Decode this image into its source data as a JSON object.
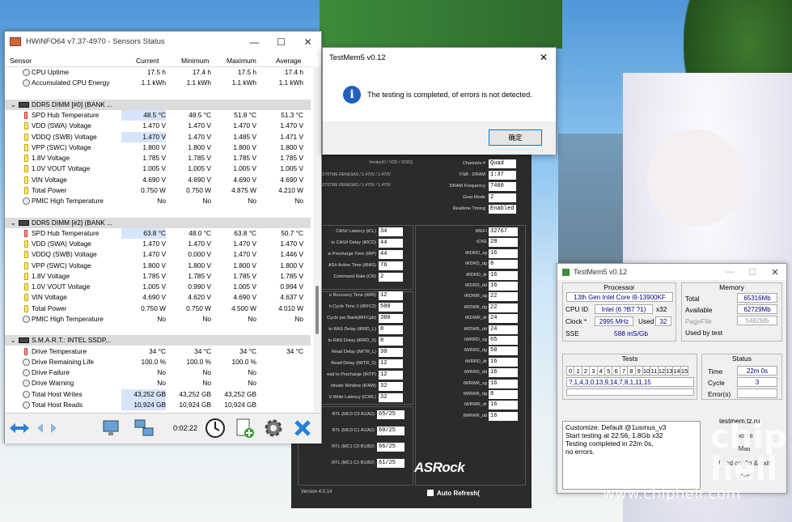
{
  "hwinfo": {
    "title": "HWiNFO64 v7.37-4970 - Sensors Status",
    "columns": {
      "sensor": "Sensor",
      "current": "Current",
      "minimum": "Minimum",
      "maximum": "Maximum",
      "average": "Average"
    },
    "rows": [
      {
        "kind": "item",
        "icon": "clock",
        "name": "CPU Uptime",
        "cur": "17.5 h",
        "min": "17.4 h",
        "max": "17.5 h",
        "avg": "17.4 h"
      },
      {
        "kind": "item",
        "icon": "clock",
        "name": "Accumulated CPU Energy",
        "cur": "1.1 kWh",
        "min": "1.1 kWh",
        "max": "1.1 kWh",
        "avg": "1.1 kWh"
      },
      {
        "kind": "blank"
      },
      {
        "kind": "group",
        "name": "DDR5 DIMM [#0] (BANK ..."
      },
      {
        "kind": "item",
        "icon": "temp",
        "name": "SPD Hub Temperature",
        "cur": "48.5 °C",
        "min": "48.5 °C",
        "max": "51.8 °C",
        "avg": "51.3 °C",
        "hl": true
      },
      {
        "kind": "item",
        "icon": "volt",
        "name": "VDD (SWA) Voltage",
        "cur": "1.470 V",
        "min": "1.470 V",
        "max": "1.470 V",
        "avg": "1.470 V"
      },
      {
        "kind": "item",
        "icon": "volt",
        "name": "VDDQ (SWB) Voltage",
        "cur": "1.470 V",
        "min": "1.470 V",
        "max": "1.485 V",
        "avg": "1.471 V",
        "hl": true
      },
      {
        "kind": "item",
        "icon": "volt",
        "name": "VPP (SWC) Voltage",
        "cur": "1.800 V",
        "min": "1.800 V",
        "max": "1.800 V",
        "avg": "1.800 V"
      },
      {
        "kind": "item",
        "icon": "volt",
        "name": "1.8V Voltage",
        "cur": "1.785 V",
        "min": "1.785 V",
        "max": "1.785 V",
        "avg": "1.785 V"
      },
      {
        "kind": "item",
        "icon": "volt",
        "name": "1.0V VOUT Voltage",
        "cur": "1.005 V",
        "min": "1.005 V",
        "max": "1.005 V",
        "avg": "1.005 V"
      },
      {
        "kind": "item",
        "icon": "volt",
        "name": "VIN Voltage",
        "cur": "4.690 V",
        "min": "4.690 V",
        "max": "4.690 V",
        "avg": "4.690 V"
      },
      {
        "kind": "item",
        "icon": "volt",
        "name": "Total Power",
        "cur": "0.750 W",
        "min": "0.750 W",
        "max": "4.875 W",
        "avg": "4.210 W"
      },
      {
        "kind": "item",
        "icon": "clock",
        "name": "PMIC High Temperature",
        "cur": "No",
        "min": "No",
        "max": "No",
        "avg": "No"
      },
      {
        "kind": "blank"
      },
      {
        "kind": "group",
        "name": "DDR5 DIMM [#2] (BANK ..."
      },
      {
        "kind": "item",
        "icon": "temp",
        "name": "SPD Hub Temperature",
        "cur": "63.8 °C",
        "min": "48.0 °C",
        "max": "63.8 °C",
        "avg": "50.7 °C",
        "hl": true
      },
      {
        "kind": "item",
        "icon": "volt",
        "name": "VDD (SWA) Voltage",
        "cur": "1.470 V",
        "min": "1.470 V",
        "max": "1.470 V",
        "avg": "1.470 V"
      },
      {
        "kind": "item",
        "icon": "volt",
        "name": "VDDQ (SWB) Voltage",
        "cur": "1.470 V",
        "min": "0.000 V",
        "max": "1.470 V",
        "avg": "1.446 V"
      },
      {
        "kind": "item",
        "icon": "volt",
        "name": "VPP (SWC) Voltage",
        "cur": "1.800 V",
        "min": "1.800 V",
        "max": "1.800 V",
        "avg": "1.800 V"
      },
      {
        "kind": "item",
        "icon": "volt",
        "name": "1.8V Voltage",
        "cur": "1.785 V",
        "min": "1.785 V",
        "max": "1.785 V",
        "avg": "1.785 V"
      },
      {
        "kind": "item",
        "icon": "volt",
        "name": "1.0V VOUT Voltage",
        "cur": "1.005 V",
        "min": "0.990 V",
        "max": "1.005 V",
        "avg": "0.994 V"
      },
      {
        "kind": "item",
        "icon": "volt",
        "name": "VIN Voltage",
        "cur": "4.690 V",
        "min": "4.620 V",
        "max": "4.690 V",
        "avg": "4.637 V"
      },
      {
        "kind": "item",
        "icon": "volt",
        "name": "Total Power",
        "cur": "0.750 W",
        "min": "0.750 W",
        "max": "4.500 W",
        "avg": "4.010 W"
      },
      {
        "kind": "item",
        "icon": "clock",
        "name": "PMIC High Temperature",
        "cur": "No",
        "min": "No",
        "max": "No",
        "avg": "No"
      },
      {
        "kind": "blank"
      },
      {
        "kind": "group",
        "name": "S.M.A.R.T.: INTEL SSDP..."
      },
      {
        "kind": "item",
        "icon": "temp",
        "name": "Drive Temperature",
        "cur": "34 °C",
        "min": "34 °C",
        "max": "34 °C",
        "avg": "34 °C"
      },
      {
        "kind": "item",
        "icon": "clock",
        "name": "Drive Remaining Life",
        "cur": "100.0 %",
        "min": "100.0 %",
        "max": "100.0 %",
        "avg": ""
      },
      {
        "kind": "item",
        "icon": "clock",
        "name": "Drive Failure",
        "cur": "No",
        "min": "No",
        "max": "No",
        "avg": ""
      },
      {
        "kind": "item",
        "icon": "clock",
        "name": "Drive Warning",
        "cur": "No",
        "min": "No",
        "max": "No",
        "avg": ""
      },
      {
        "kind": "item",
        "icon": "clock",
        "name": "Total Host Writes",
        "cur": "43,252 GB",
        "min": "43,252 GB",
        "max": "43,252 GB",
        "avg": "",
        "hl": true
      },
      {
        "kind": "item",
        "icon": "clock",
        "name": "Total Host Reads",
        "cur": "10,924 GB",
        "min": "10,924 GB",
        "max": "10,924 GB",
        "avg": "",
        "hl": true
      }
    ],
    "elapsed": "0:02:22"
  },
  "popup": {
    "title": "TestMem5 v0.12",
    "message": "The testing is completed, of errors is not detected.",
    "ok": "确定"
  },
  "asrock": {
    "header": {
      "vendor": "VendorID / VDD / VDDQ",
      "r1": "3276TME     RENESAS / 1.470V / 1.470V",
      "r2": "3276TME     RENESAS / 1.470V / 1.470V"
    },
    "top": [
      {
        "label": "Channels #",
        "value": "Quad"
      },
      {
        "label": "FSB : DRAM",
        "value": "1:37"
      },
      {
        "label": "DRAM Frequency",
        "value": "7400"
      },
      {
        "label": "Gear Mode",
        "value": "2"
      },
      {
        "label": "Realtime Timing",
        "value": "Enabled"
      }
    ],
    "left1": [
      {
        "label": "CAS# Latency (tCL)",
        "value": "34"
      },
      {
        "label": "to CAS# Delay (tRCD)",
        "value": "44"
      },
      {
        "label": "w Precharge Time (tRP)",
        "value": "44"
      },
      {
        "label": "AS# Active Time (tRAS)",
        "value": "76"
      },
      {
        "label": "Command Rate (CR)",
        "value": "2"
      }
    ],
    "left2": [
      {
        "label": "e Recovery Time (tWR)",
        "value": "12"
      },
      {
        "label": "h Cycle Time 2 (tRFC2)",
        "value": "500"
      },
      {
        "label": "Cycle per Bank(tRFCpb)",
        "value": "380"
      },
      {
        "label": "to RAS Delay (tRRD_L)",
        "value": "8"
      },
      {
        "label": "to RAS Delay (tRRD_S)",
        "value": "8"
      },
      {
        "label": "Read Delay (tWTR_L)",
        "value": "30"
      },
      {
        "label": "Read Delay (tWTR_S)",
        "value": "12"
      },
      {
        "label": "ead to Precharge (tRTP)",
        "value": "12"
      },
      {
        "label": "ctivate Window (tFAW)",
        "value": "32"
      },
      {
        "label": "S Write Latency (tCWL)",
        "value": "32"
      }
    ],
    "left3": [
      {
        "label": "RTL (MC0 C0 A1/A2)",
        "value": "65/25"
      },
      {
        "label": "RTL (MC0 C1 A1/A2)",
        "value": "60/25"
      },
      {
        "label": "RTL (MC1 C0 B1/B2)",
        "value": "66/25"
      },
      {
        "label": "RTL (MC1 C1 B1/B2)",
        "value": "61/25"
      }
    ],
    "right": [
      {
        "label": "tREFI",
        "value": "32767"
      },
      {
        "label": "tCKE",
        "value": "28"
      },
      {
        "label": "tRDRD_sg",
        "value": "16"
      },
      {
        "label": "tRDRD_dg",
        "value": "8"
      },
      {
        "label": "tRDRD_dr",
        "value": "16"
      },
      {
        "label": "tRDRD_dd",
        "value": "16"
      },
      {
        "label": "tRDWR_sg",
        "value": "22"
      },
      {
        "label": "tRDWR_dg",
        "value": "22"
      },
      {
        "label": "tRDWR_dr",
        "value": "24"
      },
      {
        "label": "tRDWR_dd",
        "value": "24"
      },
      {
        "label": "tWRRD_sg",
        "value": "65"
      },
      {
        "label": "tWRRD_dg",
        "value": "50"
      },
      {
        "label": "tWRRD_dr",
        "value": "16"
      },
      {
        "label": "tWRRD_dd",
        "value": "16"
      },
      {
        "label": "tWRWR_sg",
        "value": "16"
      },
      {
        "label": "tWRWR_dg",
        "value": "8"
      },
      {
        "label": "tWRWR_dr",
        "value": "16"
      },
      {
        "label": "tWRWR_dd",
        "value": "16"
      }
    ],
    "logo": "ASRock",
    "version": "Version 4.0.14",
    "auto_refresh": "Auto Refresh("
  },
  "testmem": {
    "title": "TestMem5 v0.12",
    "processor_label": "Processor",
    "processor_name": "13th Gen Intel Core i9-13900KF",
    "cpu_id_label": "CPU ID",
    "cpu_id": "Intel  (6 ?B7 ?1)",
    "cpu_x": "x32",
    "clock_label": "Clock *",
    "clock": "2995 MHz",
    "used_label": "Used",
    "used": "32",
    "sse_label": "SSE",
    "sse": "588 mS/Gb",
    "memory_label": "Memory",
    "total_label": "Total",
    "total": "65316Mb",
    "available_label": "Available",
    "available": "62729Mb",
    "pagefile_label": "PageFile",
    "pagefile": "5462Mb",
    "usedbytest_label": "Used by test",
    "tests_label": "Tests",
    "test_cells": [
      "0",
      "1",
      "2",
      "3",
      "4",
      "5",
      "6",
      "7",
      "8",
      "9",
      "10",
      "11",
      "12",
      "13",
      "14",
      "15"
    ],
    "sequence": "?,1,4,3,0,13,9,14,7,8,1,11,15",
    "status_label": "Status",
    "time_label": "Time",
    "time": "22m 0s",
    "cycle_label": "Cycle",
    "cycle": "3",
    "errors_label": "Error(s)",
    "errors": "",
    "log": [
      "Customize: Default @1usmus_v3",
      "Start testing at 22:56, 1.8Gb x32",
      "Testing completed in 22m 0s,",
      "no errors."
    ],
    "site": "testmem.tz.ru",
    "btn_home": "Home",
    "btn_mail": "Mail",
    "btn_load": "Load config & exit",
    "btn_exit": "Exit"
  },
  "watermark": "www.chiphell.com",
  "wm_logo": "chip hell"
}
